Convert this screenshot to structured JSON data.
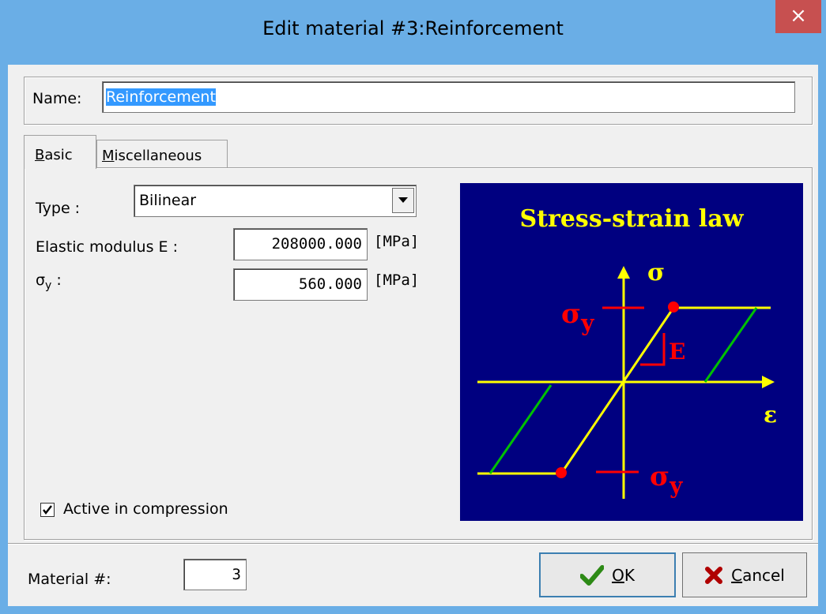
{
  "window": {
    "title": "Edit material #3:Reinforcement",
    "close_glyph": "×"
  },
  "name": {
    "label": "Name:",
    "value": "Reinforcement"
  },
  "tabs": [
    {
      "label": "Basic",
      "active": true
    },
    {
      "label": "Miscellaneous",
      "active": false
    }
  ],
  "basic": {
    "type_label": "Type :",
    "type_value": "Bilinear",
    "elastic_label": "Elastic modulus E :",
    "elastic_value": "208000.000",
    "elastic_unit": "[MPa]",
    "sigma_y_label": "σ",
    "sigma_y_sub": "y",
    "sigma_y_colon": " :",
    "sigma_y_value": "560.000",
    "sigma_y_unit": "[MPa]",
    "active_compression_label": "Active in compression",
    "active_compression_checked": true
  },
  "diagram": {
    "title": "Stress-strain law",
    "sigma_axis": "σ",
    "eps_axis": "ε",
    "sigma_y_sym": "σ",
    "sigma_y_sub": "y",
    "e_label": "E",
    "colors": {
      "background": "#000080",
      "title": "#ffff00",
      "axes": "#ffff00",
      "branch": "#ffff00",
      "unload": "#00c000",
      "marks": "#ff0000"
    }
  },
  "footer": {
    "material_label": "Material #:",
    "material_value": "3",
    "ok_label": "OK",
    "ok_underline": "O",
    "cancel_label": "Cancel",
    "cancel_underline": "C"
  }
}
